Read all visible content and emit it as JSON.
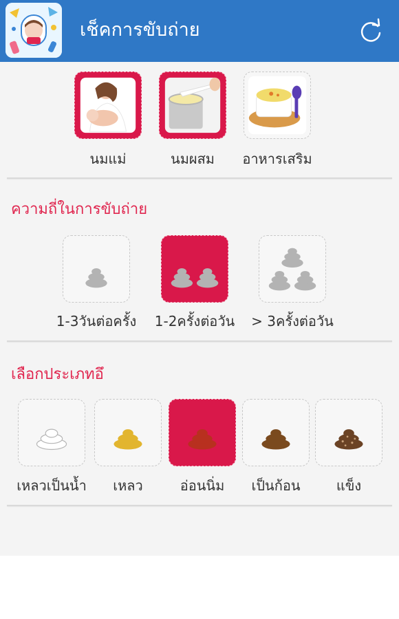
{
  "header": {
    "title": "เช็คการขับถ่าย",
    "app_icon": "baby-app-icon",
    "refresh_icon": "refresh-icon"
  },
  "food": {
    "items": [
      {
        "label": "นมแม่",
        "icon": "breastfeeding-icon",
        "selected": true
      },
      {
        "label": "นมผสม",
        "icon": "formula-milk-icon",
        "selected": true
      },
      {
        "label": "อาหารเสริม",
        "icon": "baby-food-icon",
        "selected": false
      }
    ]
  },
  "frequency": {
    "title": "ความถี่ในการขับถ่าย",
    "items": [
      {
        "label": "1-3วันต่อครั้ง",
        "icon": "poop-single-icon",
        "selected": false
      },
      {
        "label": "1-2ครั้งต่อวัน",
        "icon": "poop-double-icon",
        "selected": true
      },
      {
        "label": "> 3ครั้งต่อวัน",
        "icon": "poop-triple-icon",
        "selected": false
      }
    ]
  },
  "stool": {
    "title": "เลือกประเภทอึ",
    "items": [
      {
        "label": "เหลวเป็นน้ำ",
        "icon": "poop-watery-icon",
        "color": "#ffffff",
        "selected": false
      },
      {
        "label": "เหลว",
        "icon": "poop-loose-icon",
        "color": "#e2b52f",
        "selected": false
      },
      {
        "label": "อ่อนนิ่ม",
        "icon": "poop-soft-icon",
        "color": "#b8301f",
        "selected": true
      },
      {
        "label": "เป็นก้อน",
        "icon": "poop-formed-icon",
        "color": "#7a4a1e",
        "selected": false
      },
      {
        "label": "แข็ง",
        "icon": "poop-hard-icon",
        "color": "#6b4325",
        "selected": false
      }
    ]
  },
  "colors": {
    "header": "#2f78c6",
    "selected": "#d9184a",
    "section_title": "#e0264f"
  }
}
